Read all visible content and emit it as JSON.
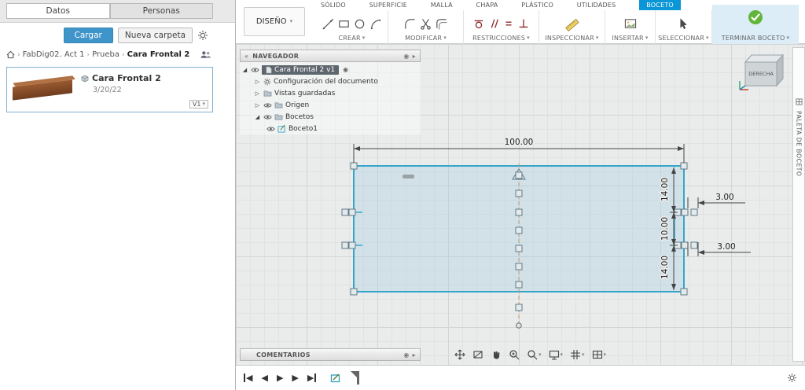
{
  "icons": {
    "caret_down": "▾",
    "chevron_sep": "›",
    "collapse_left": "«",
    "expand_open": "◢",
    "expand_closed": "▷",
    "target_dot": "◉",
    "panel_arrow": "▸",
    "tri_left": "◀",
    "tri_right": "▶"
  },
  "left_panel": {
    "tabs": [
      {
        "label": "Datos"
      },
      {
        "label": "Personas"
      }
    ],
    "upload_button": "Cargar",
    "new_folder_button": "Nueva carpeta",
    "breadcrumb": {
      "items": [
        "FabDig02. Act 1",
        "Prueba",
        "Cara Frontal 2"
      ]
    },
    "card": {
      "title": "Cara Frontal 2",
      "date": "3/20/22",
      "version": "V1"
    }
  },
  "toolbar": {
    "design_menu": "DISEÑO",
    "tabs": [
      {
        "label": "SÓLIDO"
      },
      {
        "label": "SUPERFICIE"
      },
      {
        "label": "MALLA"
      },
      {
        "label": "CHAPA"
      },
      {
        "label": "PLÁSTICO"
      },
      {
        "label": "UTILIDADES"
      },
      {
        "label": "BOCETO",
        "active": true
      }
    ],
    "groups": [
      {
        "label": "CREAR"
      },
      {
        "label": "MODIFICAR"
      },
      {
        "label": "RESTRICCIONES"
      },
      {
        "label": "INSPECCIONAR"
      },
      {
        "label": "INSERTAR"
      },
      {
        "label": "SELECCIONAR"
      }
    ],
    "finish_button": "TERMINAR BOCETO"
  },
  "navigator": {
    "title": "NAVEGADOR",
    "items": [
      {
        "label": "Cara Frontal 2 v1"
      },
      {
        "label": "Configuración del documento"
      },
      {
        "label": "Vistas guardadas"
      },
      {
        "label": "Origen"
      },
      {
        "label": "Bocetos"
      },
      {
        "label": "Boceto1"
      }
    ]
  },
  "comments_panel": {
    "title": "COMENTARIOS"
  },
  "sketch": {
    "dim_width": "100.00",
    "dim_right": [
      "14.00",
      "10.00",
      "14.00"
    ],
    "dim_offsets": [
      "3.00",
      "3.00"
    ]
  },
  "viewcube": {
    "face": "DERECHA"
  },
  "sketch_palette": {
    "label": "PALETA DE BOCETO"
  }
}
